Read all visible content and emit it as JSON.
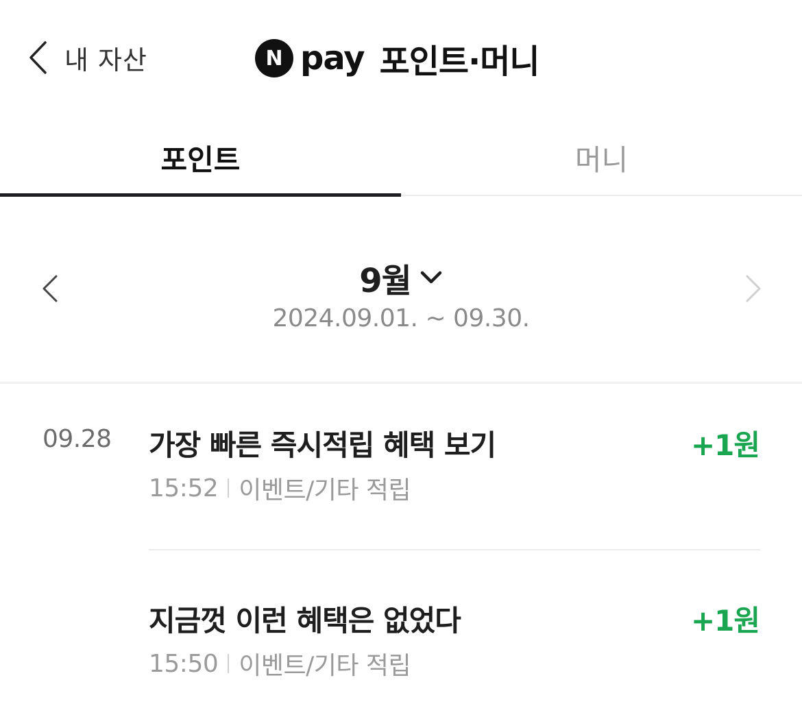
{
  "header": {
    "back_label": "내 자산",
    "brand_n": "N",
    "brand_pay": "pay",
    "title": "포인트·머니"
  },
  "tabs": [
    {
      "label": "포인트",
      "active": true
    },
    {
      "label": "머니",
      "active": false
    }
  ],
  "period": {
    "month": "9월",
    "range": "2024.09.01. ~ 09.30."
  },
  "colors": {
    "accent_green": "#1aa551",
    "tab_indicator": "#1e1e22"
  },
  "transactions": [
    {
      "date": "09.28",
      "title": "가장 빠른 즉시적립 혜택 보기",
      "time": "15:52",
      "category": "이벤트/기타 적립",
      "amount": "+1원"
    },
    {
      "date": "",
      "title": "지금껏 이런 혜택은 없었다",
      "time": "15:50",
      "category": "이벤트/기타 적립",
      "amount": "+1원"
    }
  ],
  "icons": {
    "back": "chevron-left-icon",
    "month_dropdown": "chevron-down-icon",
    "prev": "chevron-left-icon",
    "next": "chevron-right-icon"
  }
}
